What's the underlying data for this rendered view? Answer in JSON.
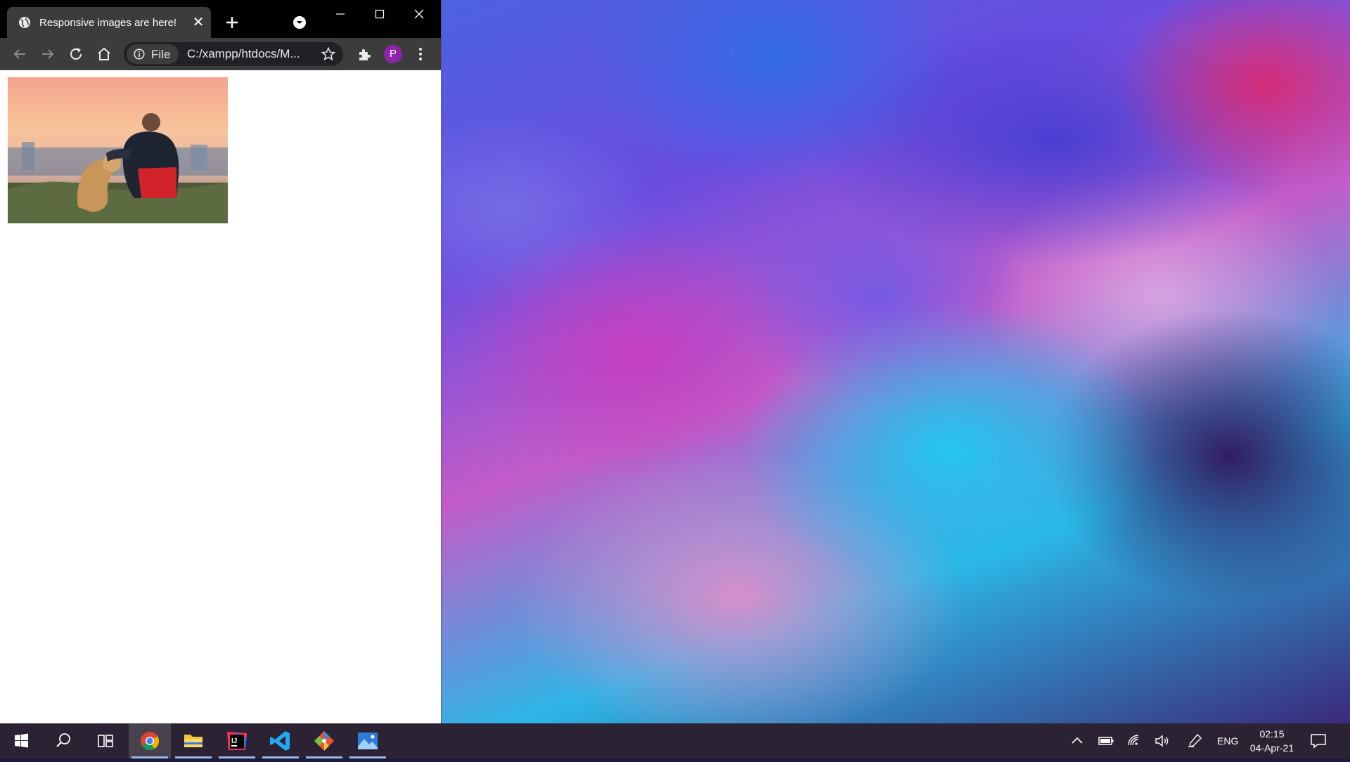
{
  "browser": {
    "tab": {
      "title": "Responsive images are here!",
      "close_label": "✕"
    },
    "new_tab_label": "+",
    "omnibox": {
      "site_info_label": "File",
      "url": "C:/xampp/htdocs/M..."
    },
    "profile_initial": "P",
    "theme_dark": "#000000",
    "toolbar_color": "#3c3c3c",
    "avatar_color": "#8e24aa"
  },
  "page": {
    "image_description_icon": "photo-man-with-dog-sunset"
  },
  "taskbar": {
    "apps": [
      {
        "name": "start",
        "icon": "windows-logo-icon"
      },
      {
        "name": "search",
        "icon": "search-icon"
      },
      {
        "name": "task-view",
        "icon": "task-view-icon"
      },
      {
        "name": "chrome",
        "icon": "chrome-icon",
        "active": true
      },
      {
        "name": "file-explorer",
        "icon": "folder-icon",
        "running": true
      },
      {
        "name": "intellij",
        "icon": "intellij-icon",
        "running": true
      },
      {
        "name": "vscode",
        "icon": "vscode-icon",
        "running": true
      },
      {
        "name": "git",
        "icon": "git-icon",
        "running": true
      },
      {
        "name": "photos",
        "icon": "photos-icon",
        "running": true
      }
    ],
    "tray": {
      "language": "ENG",
      "time": "02:15",
      "date": "04-Apr-21"
    },
    "background": "#2b2333"
  }
}
